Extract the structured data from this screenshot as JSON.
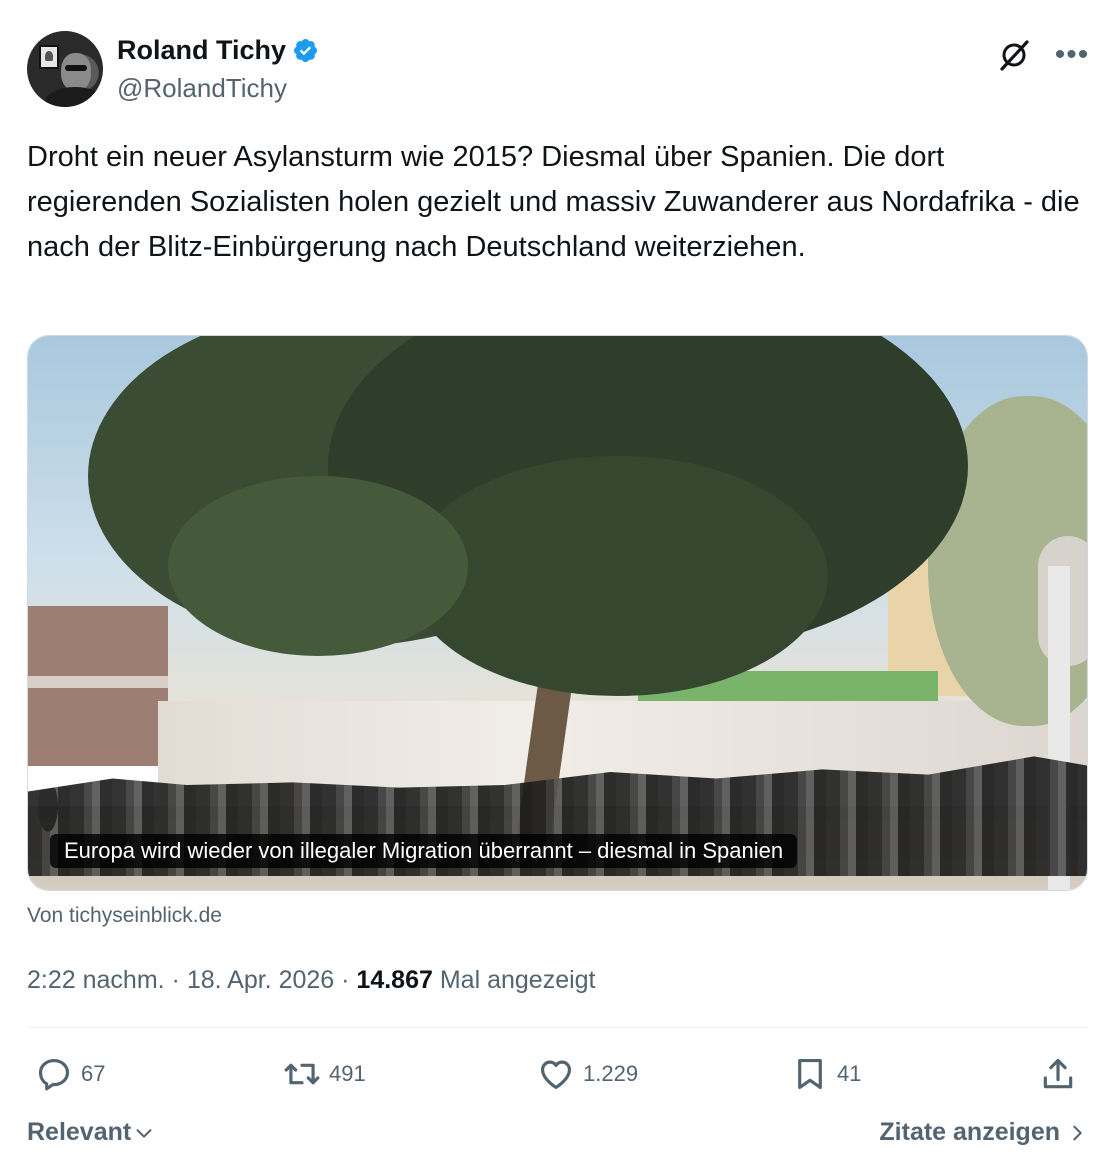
{
  "author": {
    "display_name": "Roland Tichy",
    "handle": "@RolandTichy",
    "verified": true
  },
  "tweet": {
    "text": "Droht ein neuer Asylansturm wie 2015? Diesmal über Spanien. Die dort regierenden Sozialisten holen gezielt und massiv Zuwanderer aus Nordafrika - die nach der Blitz-Einbürgerung nach Deutschland weiterziehen."
  },
  "card": {
    "caption": "Europa wird wieder von illegaler Migration überrannt – diesmal in Spanien",
    "source": "Von tichyseinblick.de"
  },
  "meta": {
    "time": "2:22 nachm.",
    "date": "18. Apr. 2026",
    "views_count": "14.867",
    "views_label": "Mal angezeigt"
  },
  "actions": {
    "replies": "67",
    "retweets": "491",
    "likes": "1.229",
    "bookmarks": "41"
  },
  "footer": {
    "sort_label": "Relevant",
    "quotes_label": "Zitate anzeigen"
  },
  "colors": {
    "verified_blue": "#1d9bf0",
    "secondary_text": "#536471",
    "primary_text": "#0f1419"
  }
}
